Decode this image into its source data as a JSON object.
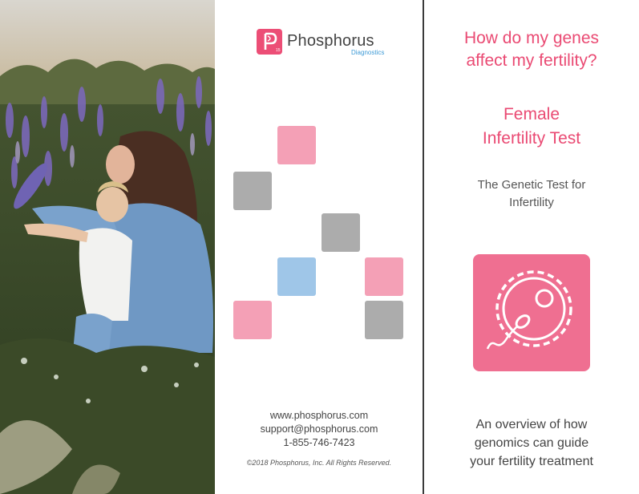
{
  "brand": {
    "name": "Phosphorus",
    "sub": "Diagnostics"
  },
  "contact": {
    "website": "www.phosphorus.com",
    "email": "support@phosphorus.com",
    "phone": "1-855-746-7423"
  },
  "copyright": "©2018 Phosphorus, Inc. All Rights Reserved.",
  "cover": {
    "question_line1": "How do my genes",
    "question_line2": "affect my fertility?",
    "product_line1": "Female",
    "product_line2": "Infertility Test",
    "tagline_line1": "The Genetic Test for",
    "tagline_line2": "Infertility",
    "overview_line1": "An overview of how",
    "overview_line2": "genomics can guide",
    "overview_line3": "your fertility treatment"
  },
  "colors": {
    "accent_pink": "#ea4a73",
    "square_pink": "#f4a0b6",
    "square_gray": "#acacac",
    "square_blue": "#9fc6e8",
    "icon_bg": "#ef6f91"
  },
  "icons": {
    "cover_icon": "egg-sperm-icon",
    "logo_icon": "phosphorus-logo-icon"
  }
}
